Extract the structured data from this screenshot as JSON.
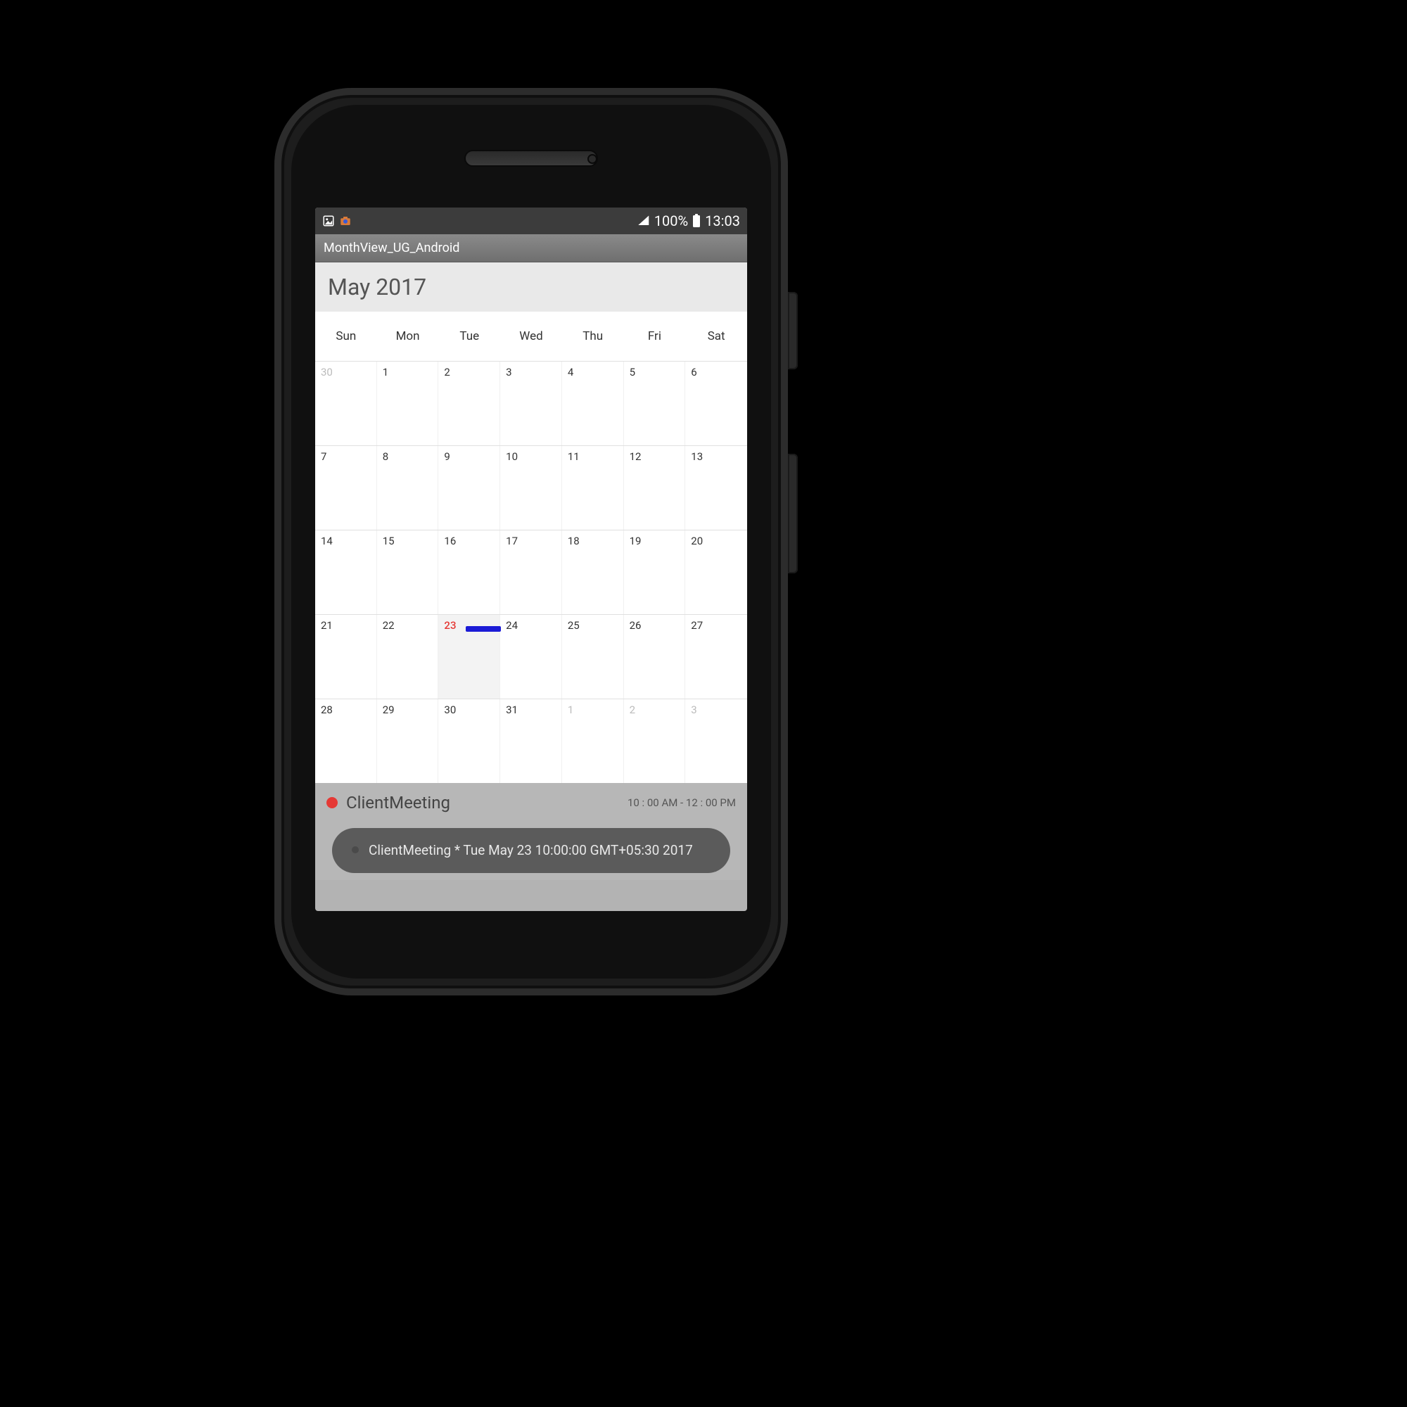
{
  "status": {
    "battery_pct": "100%",
    "clock": "13:03"
  },
  "app": {
    "title": "MonthView_UG_Android"
  },
  "month": {
    "label": "May 2017",
    "day_names": [
      "Sun",
      "Mon",
      "Tue",
      "Wed",
      "Thu",
      "Fri",
      "Sat"
    ],
    "weeks": [
      [
        {
          "n": "30",
          "out": true
        },
        {
          "n": "1"
        },
        {
          "n": "2"
        },
        {
          "n": "3"
        },
        {
          "n": "4"
        },
        {
          "n": "5"
        },
        {
          "n": "6"
        }
      ],
      [
        {
          "n": "7"
        },
        {
          "n": "8"
        },
        {
          "n": "9"
        },
        {
          "n": "10"
        },
        {
          "n": "11"
        },
        {
          "n": "12"
        },
        {
          "n": "13"
        }
      ],
      [
        {
          "n": "14"
        },
        {
          "n": "15"
        },
        {
          "n": "16"
        },
        {
          "n": "17"
        },
        {
          "n": "18"
        },
        {
          "n": "19"
        },
        {
          "n": "20"
        }
      ],
      [
        {
          "n": "21"
        },
        {
          "n": "22"
        },
        {
          "n": "23",
          "selected": true,
          "event": true
        },
        {
          "n": "24"
        },
        {
          "n": "25"
        },
        {
          "n": "26"
        },
        {
          "n": "27"
        }
      ],
      [
        {
          "n": "28"
        },
        {
          "n": "29"
        },
        {
          "n": "30"
        },
        {
          "n": "31"
        },
        {
          "n": "1",
          "out": true
        },
        {
          "n": "2",
          "out": true
        },
        {
          "n": "3",
          "out": true
        }
      ]
    ]
  },
  "agenda": {
    "title": "ClientMeeting",
    "time": "10 : 00 AM - 12 : 00 PM"
  },
  "toast": {
    "text": "ClientMeeting * Tue May 23 10:00:00 GMT+05:30 2017"
  }
}
